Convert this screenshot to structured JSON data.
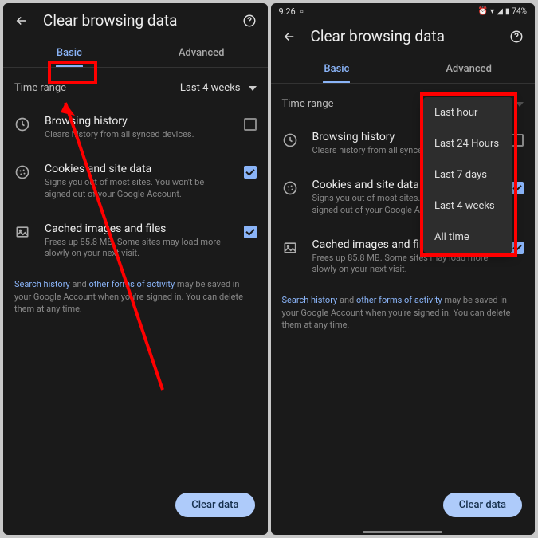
{
  "status": {
    "time": "9:26",
    "battery": "74%"
  },
  "header": {
    "title": "Clear browsing data"
  },
  "tabs": {
    "basic": "Basic",
    "advanced": "Advanced"
  },
  "time_range": {
    "label": "Time range",
    "value": "Last 4 weeks"
  },
  "options": {
    "history": {
      "title": "Browsing history",
      "sub_left": "Clears history from all synced devices.",
      "sub_right": "Clears history from all synced devices."
    },
    "cookies": {
      "title": "Cookies and site data",
      "sub": "Signs you out of most sites. You won't be signed out of your Google Account."
    },
    "cache": {
      "title": "Cached images and files",
      "sub": "Frees up 85.8 MB. Some sites may load more slowly on your next visit."
    }
  },
  "footer": {
    "link1": "Search history",
    "mid": " and ",
    "link2": "other forms of activity",
    "rest": " may be saved in your Google Account when you're signed in. You can delete them at any time."
  },
  "dropdown": {
    "items": [
      "Last hour",
      "Last 24 Hours",
      "Last 7 days",
      "Last 4 weeks",
      "All time"
    ]
  },
  "clear_button": "Clear data"
}
